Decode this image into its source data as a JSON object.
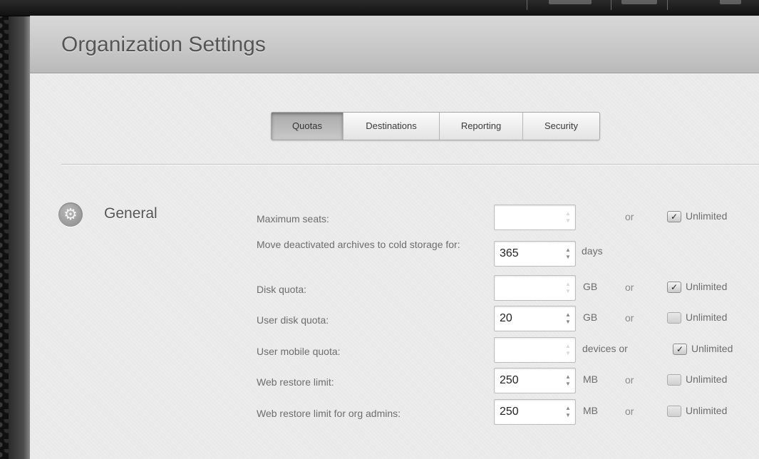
{
  "header": {
    "title": "Organization Settings"
  },
  "tabs": [
    {
      "label": "Quotas",
      "active": true
    },
    {
      "label": "Destinations",
      "active": false
    },
    {
      "label": "Reporting",
      "active": false
    },
    {
      "label": "Security",
      "active": false
    }
  ],
  "section": {
    "title": "General",
    "icon": "gear-icon"
  },
  "rows": {
    "max_seats": {
      "label": "Maximum seats:",
      "value": "",
      "unit": "",
      "or": "or",
      "unlimited": {
        "label": "Unlimited",
        "checked": true
      }
    },
    "cold_storage": {
      "label": "Move deactivated archives to cold storage for:",
      "value": "365",
      "unit": "days"
    },
    "disk_quota": {
      "label": "Disk quota:",
      "value": "",
      "unit": "GB",
      "or": "or",
      "unlimited": {
        "label": "Unlimited",
        "checked": true
      }
    },
    "user_disk_quota": {
      "label": "User disk quota:",
      "value": "20",
      "unit": "GB",
      "or": "or",
      "unlimited": {
        "label": "Unlimited",
        "checked": false
      }
    },
    "user_mobile_quota": {
      "label": "User mobile quota:",
      "value": "",
      "unit": "devices or",
      "unlimited": {
        "label": "Unlimited",
        "checked": true
      }
    },
    "web_restore_limit": {
      "label": "Web restore limit:",
      "value": "250",
      "unit": "MB",
      "or": "or",
      "unlimited": {
        "label": "Unlimited",
        "checked": false
      }
    },
    "web_restore_limit_admins": {
      "label": "Web restore limit for org admins:",
      "value": "250",
      "unit": "MB",
      "or": "or",
      "unlimited": {
        "label": "Unlimited",
        "checked": false
      }
    }
  },
  "glyphs": {
    "check": "✓",
    "spin_up": "▲",
    "spin_down": "▼",
    "gear": "⚙"
  }
}
